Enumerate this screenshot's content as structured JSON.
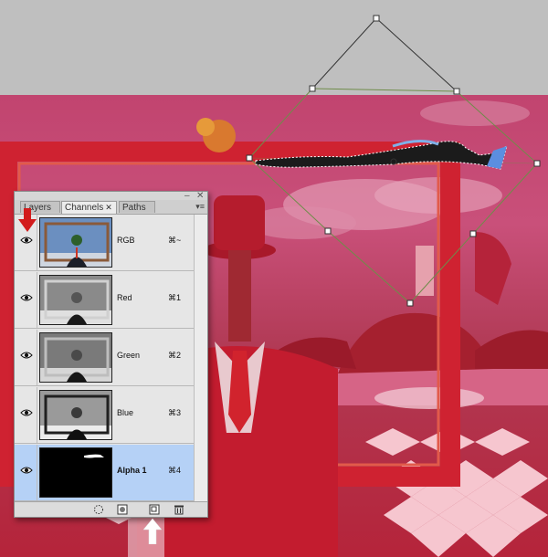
{
  "panel": {
    "tabs": [
      {
        "label": "Layers"
      },
      {
        "label": "Channels",
        "close": "✕"
      },
      {
        "label": "Paths"
      }
    ],
    "menu_glyph": "▾≡",
    "close_glyph": "✕",
    "minimize_glyph": "–",
    "channels": [
      {
        "name": "RGB",
        "shortcut": "⌘~"
      },
      {
        "name": "Red",
        "shortcut": "⌘1"
      },
      {
        "name": "Green",
        "shortcut": "⌘2"
      },
      {
        "name": "Blue",
        "shortcut": "⌘3"
      },
      {
        "name": "Alpha 1",
        "shortcut": "⌘4",
        "selected": true
      }
    ]
  },
  "colors": {
    "selection": "#b5d1f6",
    "overlay_red": "#cc1b2c",
    "arrow_red": "#d21c1c",
    "arrow_white": "#ffffff"
  }
}
